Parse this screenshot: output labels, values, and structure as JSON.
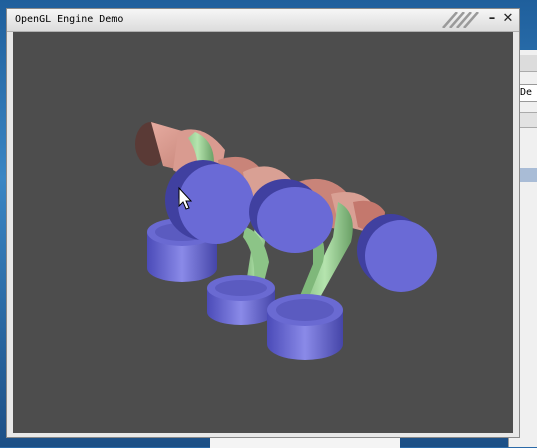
{
  "window": {
    "title": "OpenGL Engine Demo",
    "minimize_glyph": "–",
    "close_glyph": "✕"
  },
  "background_window": {
    "field_text": "/De"
  },
  "scene": {
    "description_icon": "engine-3d-render",
    "colors": {
      "background": "#4d4d4d",
      "piston": "#6b6bd6",
      "piston_dark": "#4a4ab0",
      "crankshaft": "#d4948a",
      "crankshaft_dark": "#a8665e",
      "connecting_rod": "#9fd39a",
      "connecting_rod_dark": "#6fa86c"
    }
  },
  "cursor": {
    "icon": "mouse-pointer-icon"
  }
}
